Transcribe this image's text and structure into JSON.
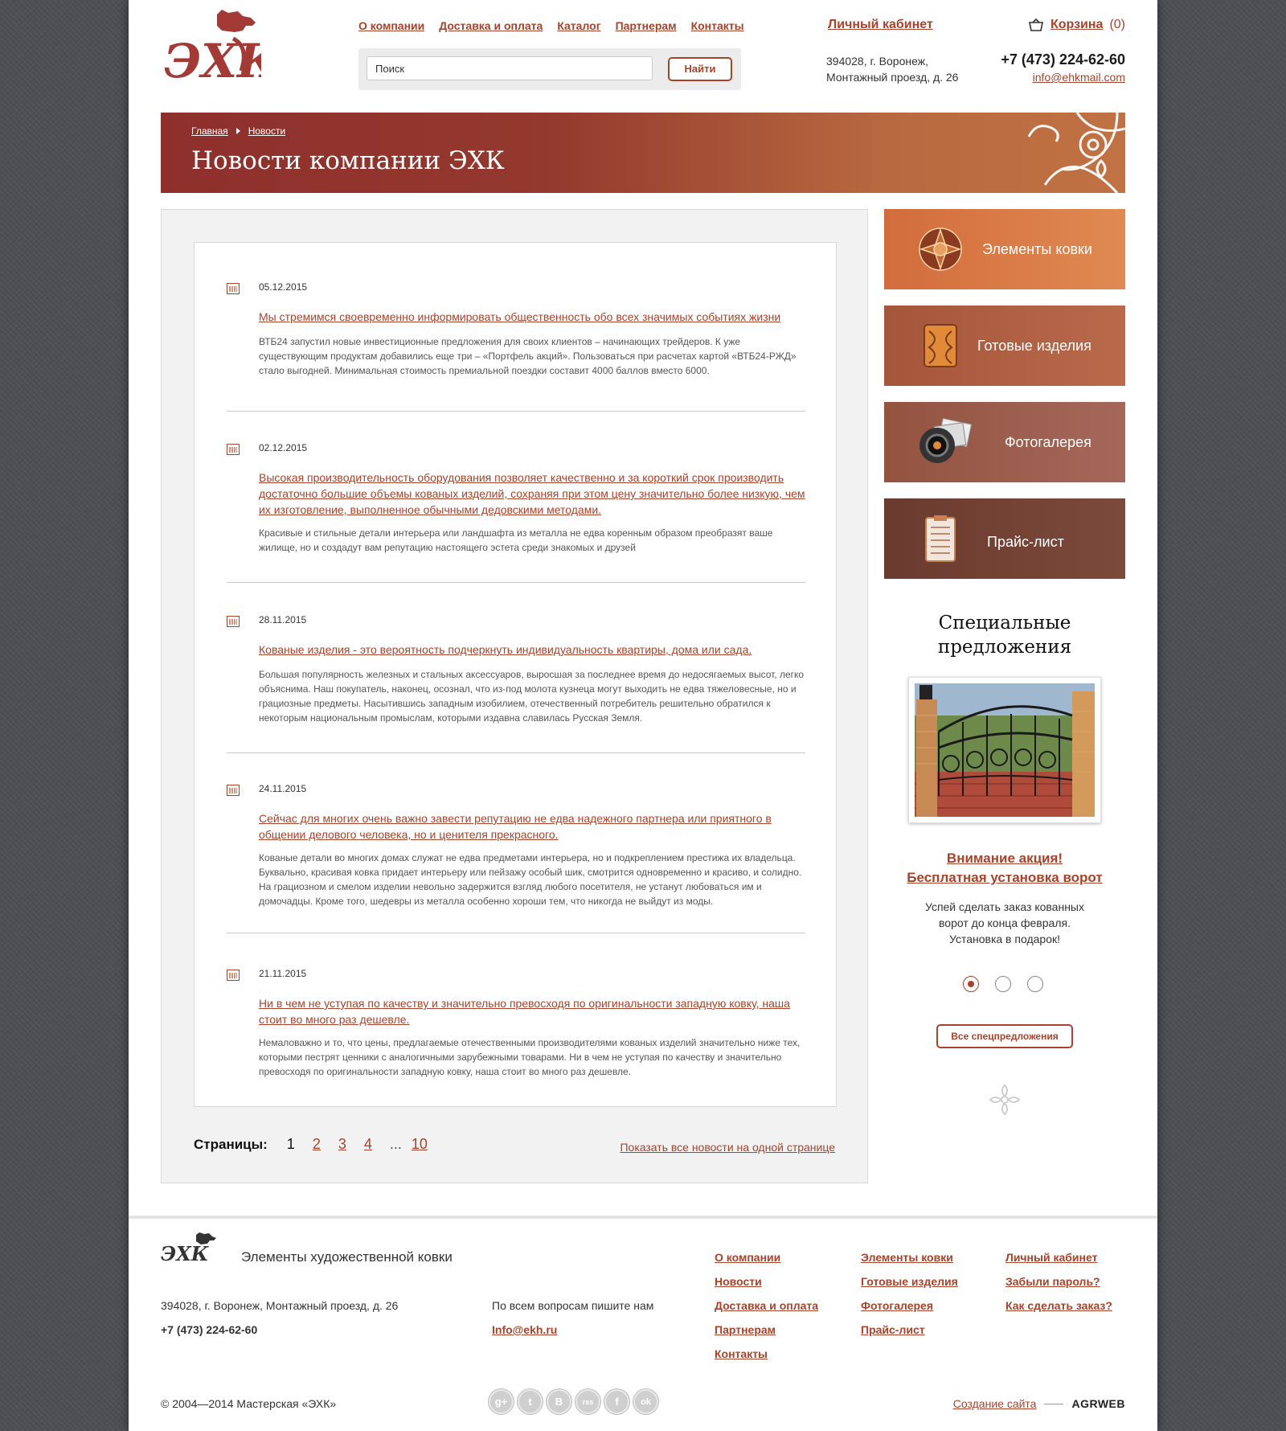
{
  "header": {
    "nav": [
      "О компании",
      "Доставка и оплата",
      "Каталог",
      "Партнерам",
      "Контакты"
    ],
    "search_placeholder": "Поиск",
    "search_button": "Найти",
    "cabinet": "Личный кабинет",
    "cart_label": "Корзина",
    "cart_count": "(0)",
    "address_line1": "394028, г. Воронеж,",
    "address_line2": "Монтажный проезд, д. 26",
    "phone": "+7 (473) 224-62-60",
    "email": "info@ehkmail.com",
    "logo_text": "ЭХК"
  },
  "banner": {
    "crumb_home": "Главная",
    "crumb_current": "Новости",
    "title": "Новости компании ЭХК"
  },
  "news": [
    {
      "date": "05.12.2015",
      "title": "Мы стремимся своевременно информировать общественность обо всех значимых событиях жизни",
      "text": "ВТБ24 запустил новые инвестиционные предложения для своих клиентов – начинающих трейдеров. К уже существующим продуктам добавились еще три – «Портфель акций». Пользоваться при расчетах картой «ВТБ24-РЖД» стало выгодней. Минимальная стоимость премиальной поездки составит 4000 баллов вместо 6000."
    },
    {
      "date": "02.12.2015",
      "title": "Высокая производительность оборудования позволяет качественно и за короткий срок производить достаточно большие объемы кованых изделий, сохраняя при этом цену значительно более низкую, чем их изготовление, выполненное обычными дедовскими методами.",
      "text": "Красивые и стильные детали интерьера или ландшафта из металла не едва коренным образом преобразят ваше жилище, но и создадут вам репутацию настоящего эстета среди знакомых и друзей"
    },
    {
      "date": "28.11.2015",
      "title": "Кованые изделия - это вероятность подчеркнуть индивидуальность квартиры, дома или сада.",
      "text": "Большая популярность железных и стальных аксессуаров, выросшая за последнее время до недосягаемых высот, легко объяснима. Наш покупатель, наконец, осознал, что из-под молота кузнеца могут выходить не едва тяжеловесные, но и грациозные предметы. Насытившись западным изобилием, отечественный потребитель решительно обратился к некоторым национальным промыслам, которыми издавна славилась Русская Земля."
    },
    {
      "date": "24.11.2015",
      "title": "Сейчас для многих очень важно завести репутацию не едва надежного партнера или приятного в общении делового человека, но и ценителя прекрасного.",
      "text": "Кованые детали во многих домах служат не едва предметами интерьера, но и подкреплением престижа их владельца. Буквально, красивая ковка придает интерьеру или пейзажу особый шик, смотрится одновременно и красиво, и солидно. На грациозном и смелом изделии невольно задержится взгляд любого посетителя, не устанут любоваться им и домочадцы. Кроме того, шедевры из металла особенно хороши тем, что никогда не выйдут из моды."
    },
    {
      "date": "21.11.2015",
      "title": "Ни в чем не уступая по качеству и значительно превосходя по оригинальности западную ковку, наша стоит во много раз дешевле.",
      "text": "Немаловажно и то, что цены, предлагаемые отечественными производителями кованых изделий значительно ниже тех, которыми пестрят ценники с аналогичными зарубежными товарами. Ни в чем не уступая по качеству и значительно превосходя по оригинальности западную ковку, наша стоит во много раз дешевле."
    }
  ],
  "pager": {
    "label": "Страницы:",
    "pages": [
      "1",
      "2",
      "3",
      "4"
    ],
    "dots": "...",
    "last": "10",
    "show_all": "Показать все новости на одной странице"
  },
  "sidebar": {
    "tiles": [
      {
        "label": "Элементы ковки",
        "color": "#d97a45",
        "icon": "rosette-icon"
      },
      {
        "label": "Готовые изделия",
        "color": "#b2603f",
        "icon": "forged-panel-icon"
      },
      {
        "label": "Фотогалерея",
        "color": "#9d5c4a",
        "icon": "camera-icon"
      },
      {
        "label": "Прайс-лист",
        "color": "#6e3e31",
        "icon": "clipboard-icon"
      }
    ],
    "special_title_1": "Специальные",
    "special_title_2": "предложения",
    "promo_title_1": "Внимание акция!",
    "promo_title_2": "Бесплатная установка ворот",
    "promo_text": "Успей сделать заказ кованных ворот до конца февраля. Установка в подарок!",
    "all_offers": "Все спецпредложения"
  },
  "footer": {
    "tagline": "Элементы художественной ковки",
    "address": "394028, г. Воронеж, Монтажный проезд, д. 26",
    "phone": "+7 (473) 224-62-60",
    "question": "По всем вопросам пишите нам",
    "email": "Info@ekh.ru",
    "col1": [
      "О компании",
      "Новости",
      "Доставка и оплата",
      "Партнерам",
      "Контакты"
    ],
    "col2": [
      "Элементы ковки",
      "Готовые изделия",
      "Фотогалерея",
      "Прайс-лист"
    ],
    "col3": [
      "Личный кабинет",
      "Забыли пароль?",
      "Как сделать заказ?"
    ],
    "copyright": "© 2004—2014 Мастерская «ЭХК»",
    "social": [
      "g+",
      "t",
      "B",
      "rss",
      "f",
      "ok"
    ],
    "made_label": "Создание сайта",
    "made_by": "AGRWEB"
  }
}
